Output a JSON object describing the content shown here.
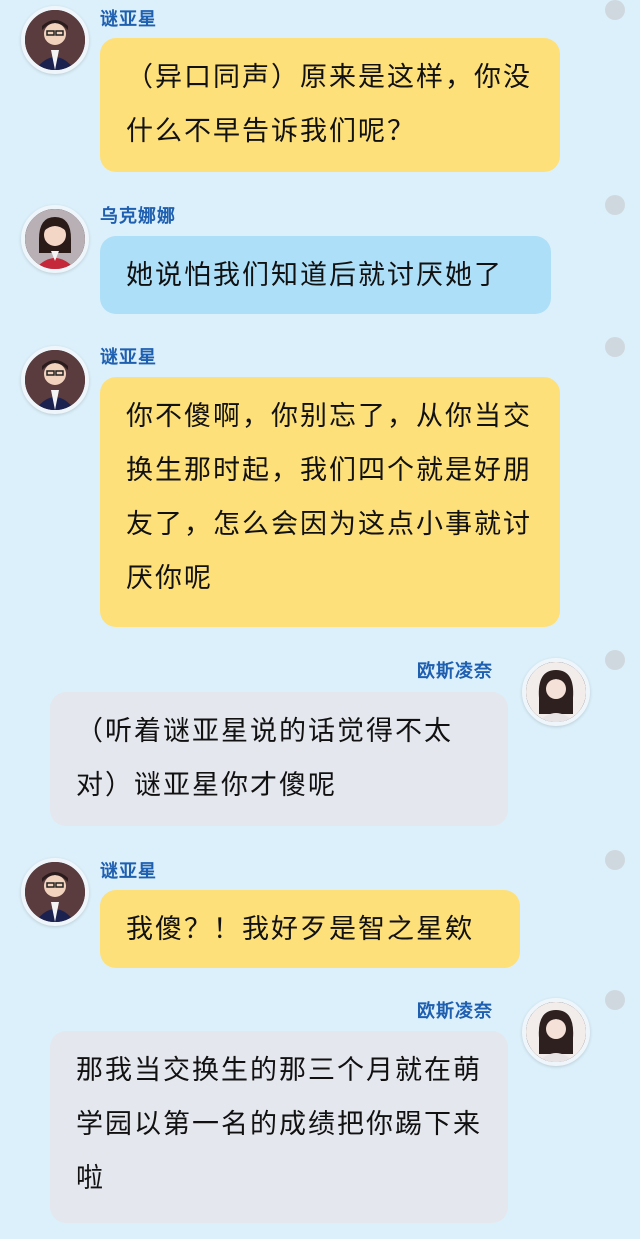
{
  "messages": [
    {
      "sender": "谜亚星",
      "text": "（异口同声）原来是这样，你没什么不早告诉我们呢？"
    },
    {
      "sender": "乌克娜娜",
      "text": "她说怕我们知道后就讨厌她了"
    },
    {
      "sender": "谜亚星",
      "text": "你不傻啊，你别忘了，从你当交换生那时起，我们四个就是好朋友了，怎么会因为这点小事就讨厌你呢"
    },
    {
      "sender": "欧斯凌奈",
      "text": "（听着谜亚星说的话觉得不太对）谜亚星你才傻呢"
    },
    {
      "sender": "谜亚星",
      "text": "我傻？！我好歹是智之星欸"
    },
    {
      "sender": "欧斯凌奈",
      "text": "那我当交换生的那三个月就在萌学园以第一名的成绩把你踢下来啦"
    }
  ],
  "colors": {
    "background": "#dcf0fb",
    "bubble_yellow": "#fde07a",
    "bubble_blue": "#aedff8",
    "bubble_gray": "#e4e7ee",
    "name_color": "#1f5fb0"
  },
  "icons": [
    "avatar-miyaxing",
    "avatar-wukenana",
    "avatar-ousilingnai",
    "status-dot"
  ]
}
